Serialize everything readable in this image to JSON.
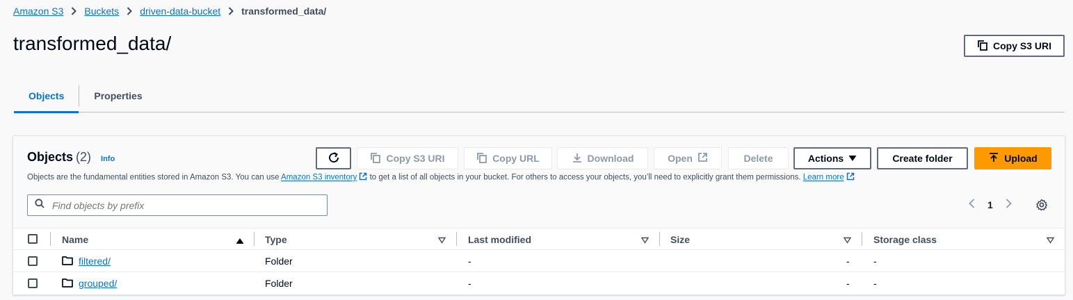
{
  "breadcrumb": {
    "items": [
      "Amazon S3",
      "Buckets",
      "driven-data-bucket"
    ],
    "current": "transformed_data/"
  },
  "page": {
    "title": "transformed_data/",
    "copy_uri_label": "Copy S3 URI"
  },
  "tabs": [
    {
      "label": "Objects",
      "active": true
    },
    {
      "label": "Properties",
      "active": false
    }
  ],
  "objects_panel": {
    "title": "Objects",
    "count": "(2)",
    "info": "Info",
    "description_prefix": "Objects are the fundamental entities stored in Amazon S3. You can use",
    "inventory_link": "Amazon S3 inventory",
    "description_middle": "to get a list of all objects in your bucket. For others to access your objects, you’ll need to explicitly grant them permissions.",
    "learn_more": "Learn more",
    "toolbar": {
      "refresh_icon": "refresh-icon",
      "copy_s3_uri": "Copy S3 URI",
      "copy_url": "Copy URL",
      "download": "Download",
      "open": "Open",
      "delete": "Delete",
      "actions": "Actions",
      "create_folder": "Create folder",
      "upload": "Upload"
    },
    "search_placeholder": "Find objects by prefix",
    "pagination": {
      "current_page": "1"
    }
  },
  "table": {
    "columns": [
      "Name",
      "Type",
      "Last modified",
      "Size",
      "Storage class"
    ],
    "rows": [
      {
        "name": "filtered/",
        "type": "Folder",
        "last_modified": "-",
        "size": "-",
        "storage_class": "-"
      },
      {
        "name": "grouped/",
        "type": "Folder",
        "last_modified": "-",
        "size": "-",
        "storage_class": "-"
      }
    ]
  },
  "colors": {
    "link": "#0972d3",
    "primary_button": "#ff9900",
    "text": "#16191f",
    "disabled_text": "#8d99a8"
  }
}
